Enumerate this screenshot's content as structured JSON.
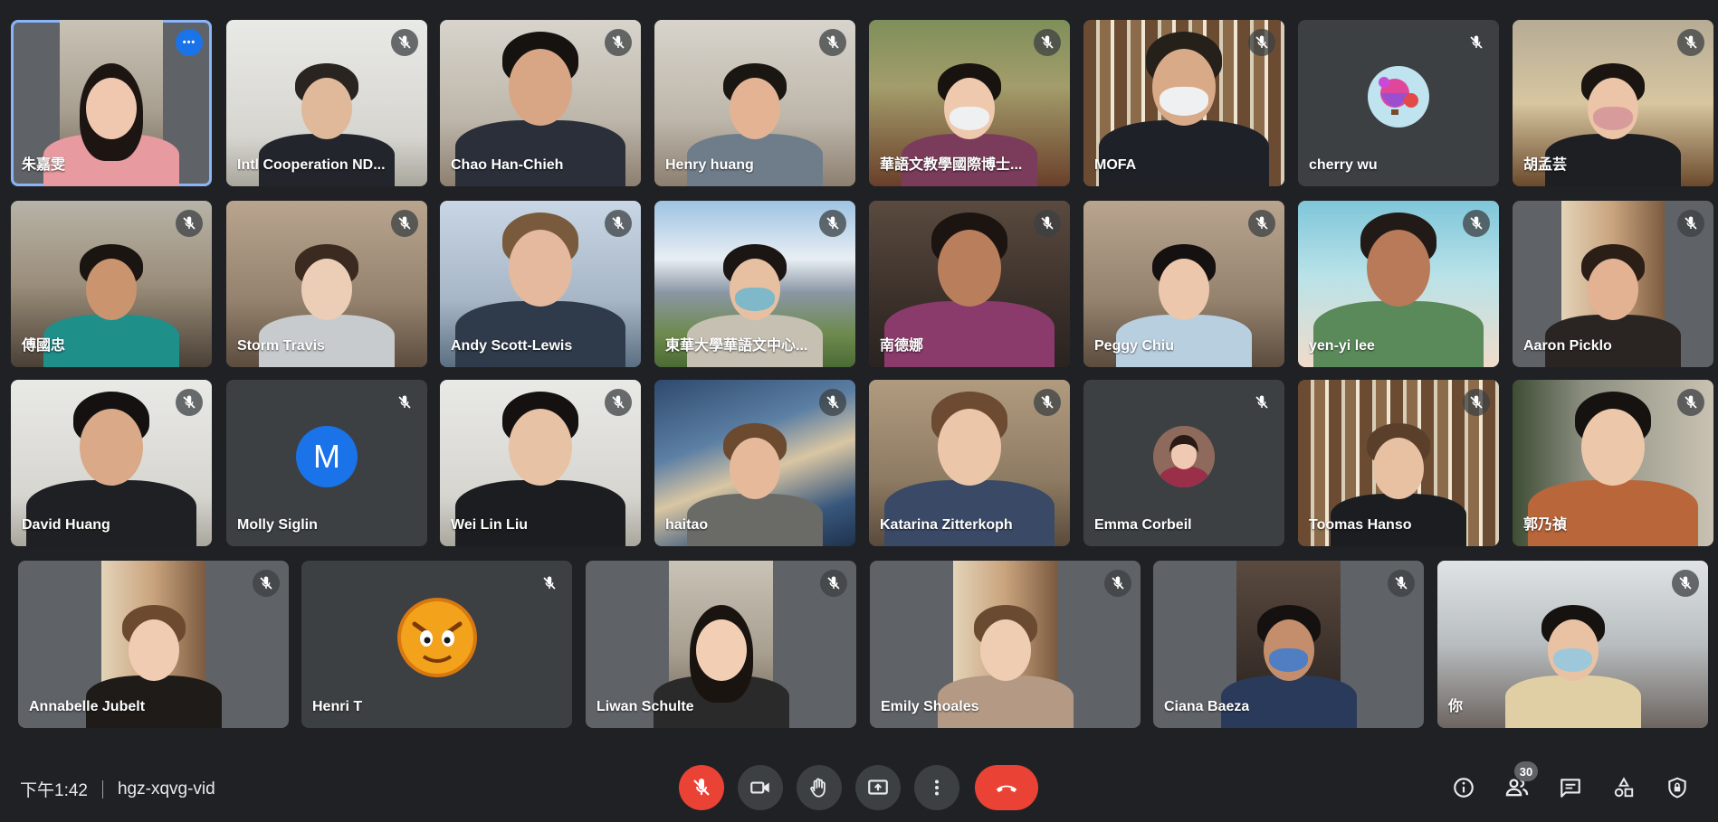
{
  "participants": [
    {
      "name": "朱嘉雯",
      "muted": false,
      "active": true,
      "has_more_menu": true
    },
    {
      "name": "Intl Cooperation ND...",
      "muted": true
    },
    {
      "name": "Chao Han-Chieh",
      "muted": true
    },
    {
      "name": "Henry huang",
      "muted": true
    },
    {
      "name": "華語文教學國際博士...",
      "muted": true
    },
    {
      "name": "MOFA",
      "muted": true
    },
    {
      "name": "cherry wu",
      "muted": true,
      "avatar": "hot-air-balloon"
    },
    {
      "name": "胡孟芸",
      "muted": true
    },
    {
      "name": "傅國忠",
      "muted": true
    },
    {
      "name": "Storm Travis",
      "muted": true
    },
    {
      "name": "Andy Scott-Lewis",
      "muted": true
    },
    {
      "name": "東華大學華語文中心...",
      "muted": true
    },
    {
      "name": "南德娜",
      "muted": true
    },
    {
      "name": "Peggy Chiu",
      "muted": true
    },
    {
      "name": "yen-yi lee",
      "muted": true
    },
    {
      "name": "Aaron Picklo",
      "muted": true
    },
    {
      "name": "David Huang",
      "muted": true
    },
    {
      "name": "Molly Siglin",
      "muted": true,
      "avatar_letter": "M",
      "avatar_color": "#1a73e8"
    },
    {
      "name": "Wei Lin Liu",
      "muted": true
    },
    {
      "name": "haitao",
      "muted": true
    },
    {
      "name": "Katarina Zitterkoph",
      "muted": true
    },
    {
      "name": "Emma Corbeil",
      "muted": true,
      "avatar": "photo"
    },
    {
      "name": "Toomas Hanso",
      "muted": true
    },
    {
      "name": "郭乃禎",
      "muted": true
    },
    {
      "name": "Annabelle Jubelt",
      "muted": true
    },
    {
      "name": "Henri T",
      "muted": true,
      "avatar": "cartoon-face"
    },
    {
      "name": "Liwan Schulte",
      "muted": true
    },
    {
      "name": "Emily Shoales",
      "muted": true
    },
    {
      "name": "Ciana Baeza",
      "muted": true
    },
    {
      "name": "你",
      "muted": true,
      "is_self": true
    }
  ],
  "bottom_bar": {
    "time": "下午1:42",
    "meeting_code": "hgz-xqvg-vid",
    "participant_count": "30"
  },
  "controls": [
    "mic-off",
    "camera",
    "raise-hand",
    "present",
    "more-options",
    "leave-call"
  ],
  "right_controls": [
    "meeting-details",
    "people",
    "chat",
    "activities",
    "host-controls"
  ],
  "colors": {
    "background": "#202124",
    "tile": "#3c4043",
    "accent": "#8ab4f8",
    "danger": "#ea4335",
    "button": "#3c4043"
  }
}
